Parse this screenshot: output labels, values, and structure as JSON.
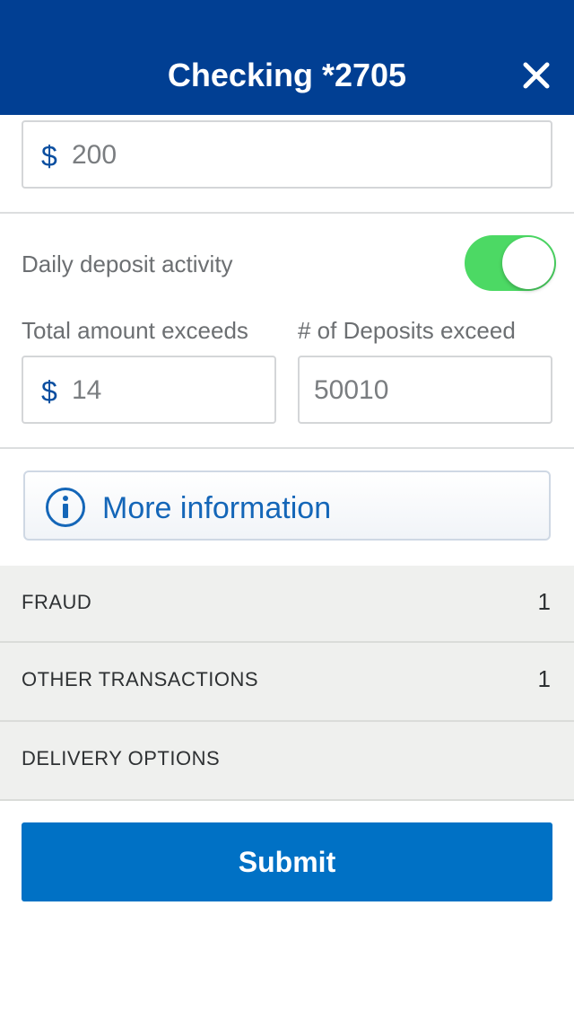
{
  "header": {
    "title": "Checking *2705",
    "close_icon": "close-icon"
  },
  "top_amount": {
    "currency": "$",
    "value": "200"
  },
  "daily_deposit": {
    "label": "Daily deposit activity",
    "toggle_on": true,
    "toggle_color": "#4cd964",
    "total_label": "Total amount exceeds",
    "total_currency": "$",
    "total_value": "14",
    "count_label": "# of Deposits exceed",
    "count_value": "50010"
  },
  "more_info": {
    "icon": "info-icon",
    "label": "More information"
  },
  "sections": [
    {
      "name": "FRAUD",
      "count": "1"
    },
    {
      "name": "OTHER TRANSACTIONS",
      "count": "1"
    },
    {
      "name": "DELIVERY OPTIONS",
      "count": ""
    }
  ],
  "submit": {
    "label": "Submit",
    "color": "#0071c5"
  },
  "colors": {
    "header_bg": "#013f93",
    "accent_text": "#1466b8"
  }
}
